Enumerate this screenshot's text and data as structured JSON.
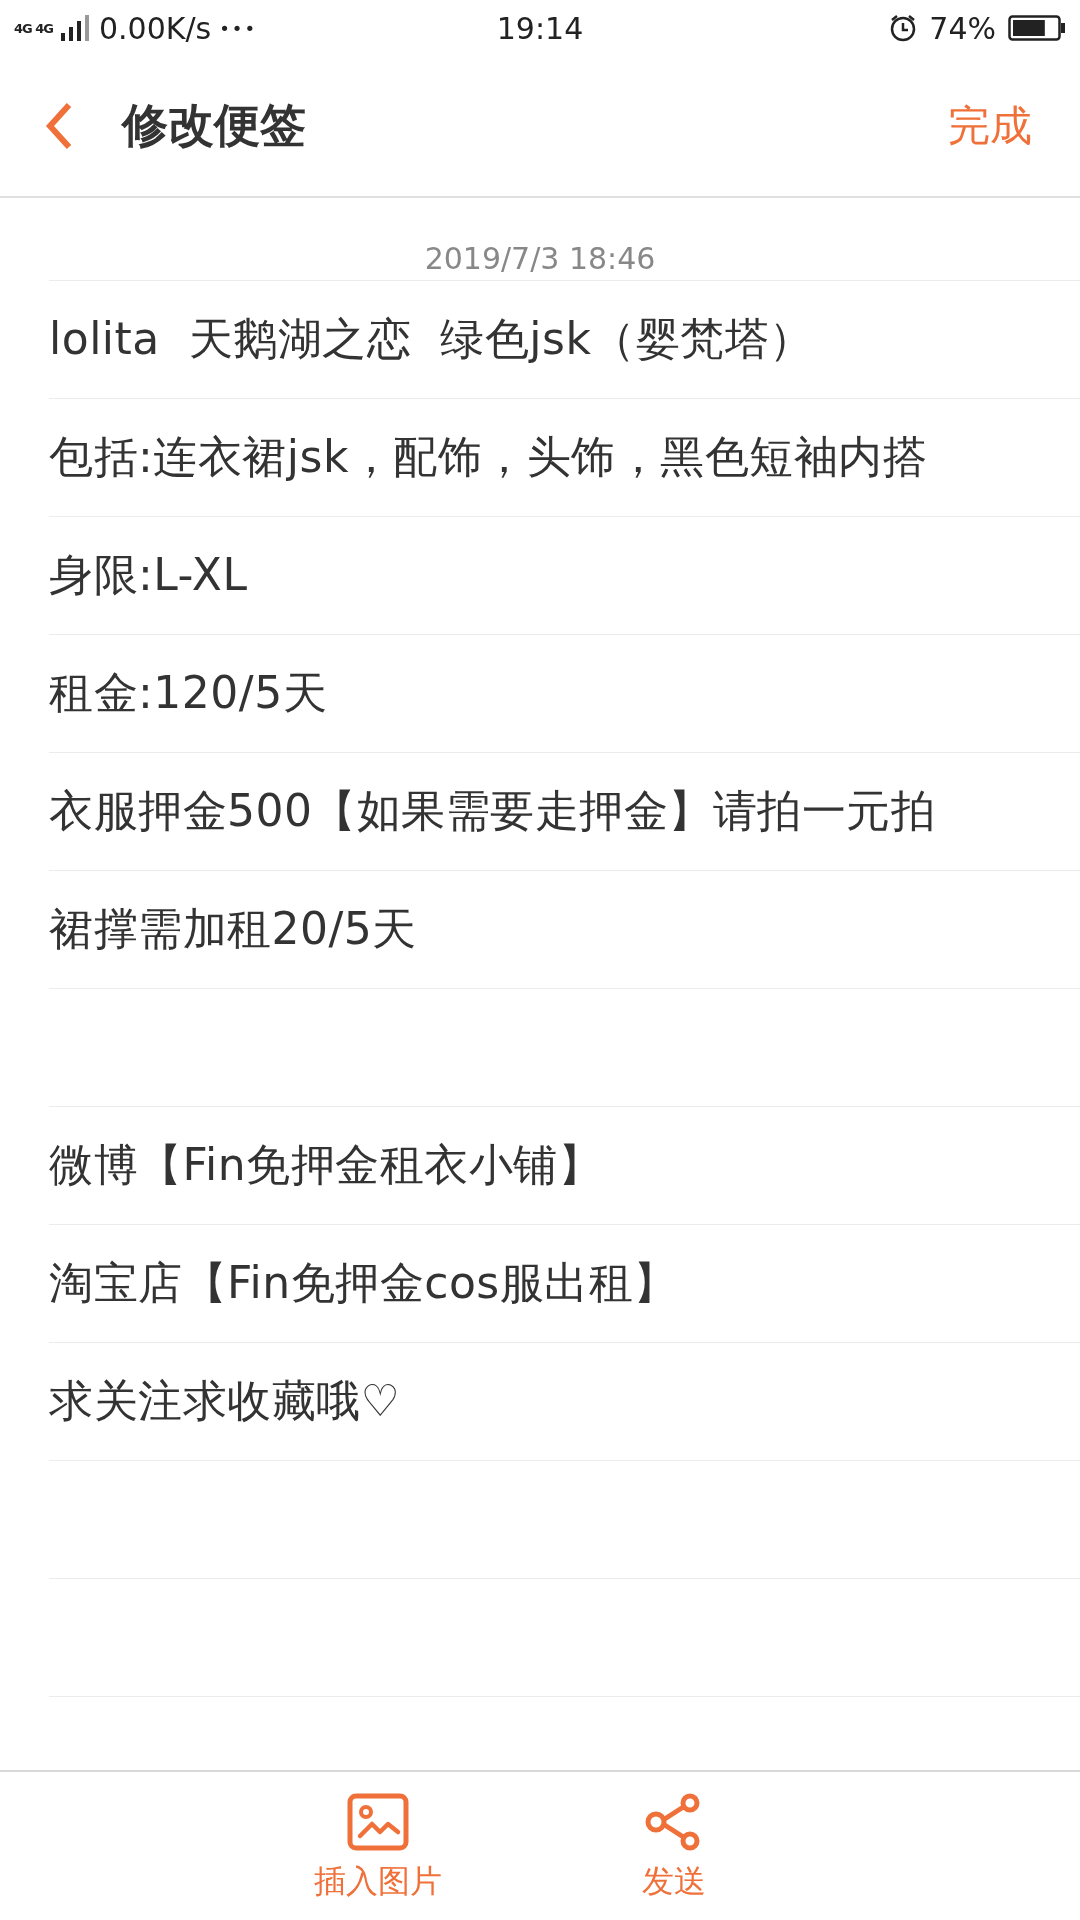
{
  "status_bar": {
    "network": "4G 4G",
    "speed": "0.00K/s",
    "more": "•••",
    "time": "19:14",
    "battery": "74%"
  },
  "header": {
    "title": "修改便签",
    "done": "完成"
  },
  "note": {
    "timestamp": "2019/7/3 18:46",
    "blocks": [
      [
        "lolita  天鹅湖之恋  绿色jsk（婴梵塔）",
        "包括:连衣裙jsk，配饰，头饰，黑色短袖内搭",
        "身限:L-XL",
        "租金:120/5天",
        "衣服押金500【如果需要走押金】请拍一元拍",
        "裙撑需加租20/5天"
      ],
      [
        "微博【Fin免押金租衣小铺】",
        "淘宝店【Fin免押金cos服出租】",
        "求关注求收藏哦♡"
      ]
    ]
  },
  "toolbar": [
    {
      "kind": "image",
      "label": "插入图片"
    },
    {
      "kind": "share",
      "label": "发送"
    }
  ]
}
